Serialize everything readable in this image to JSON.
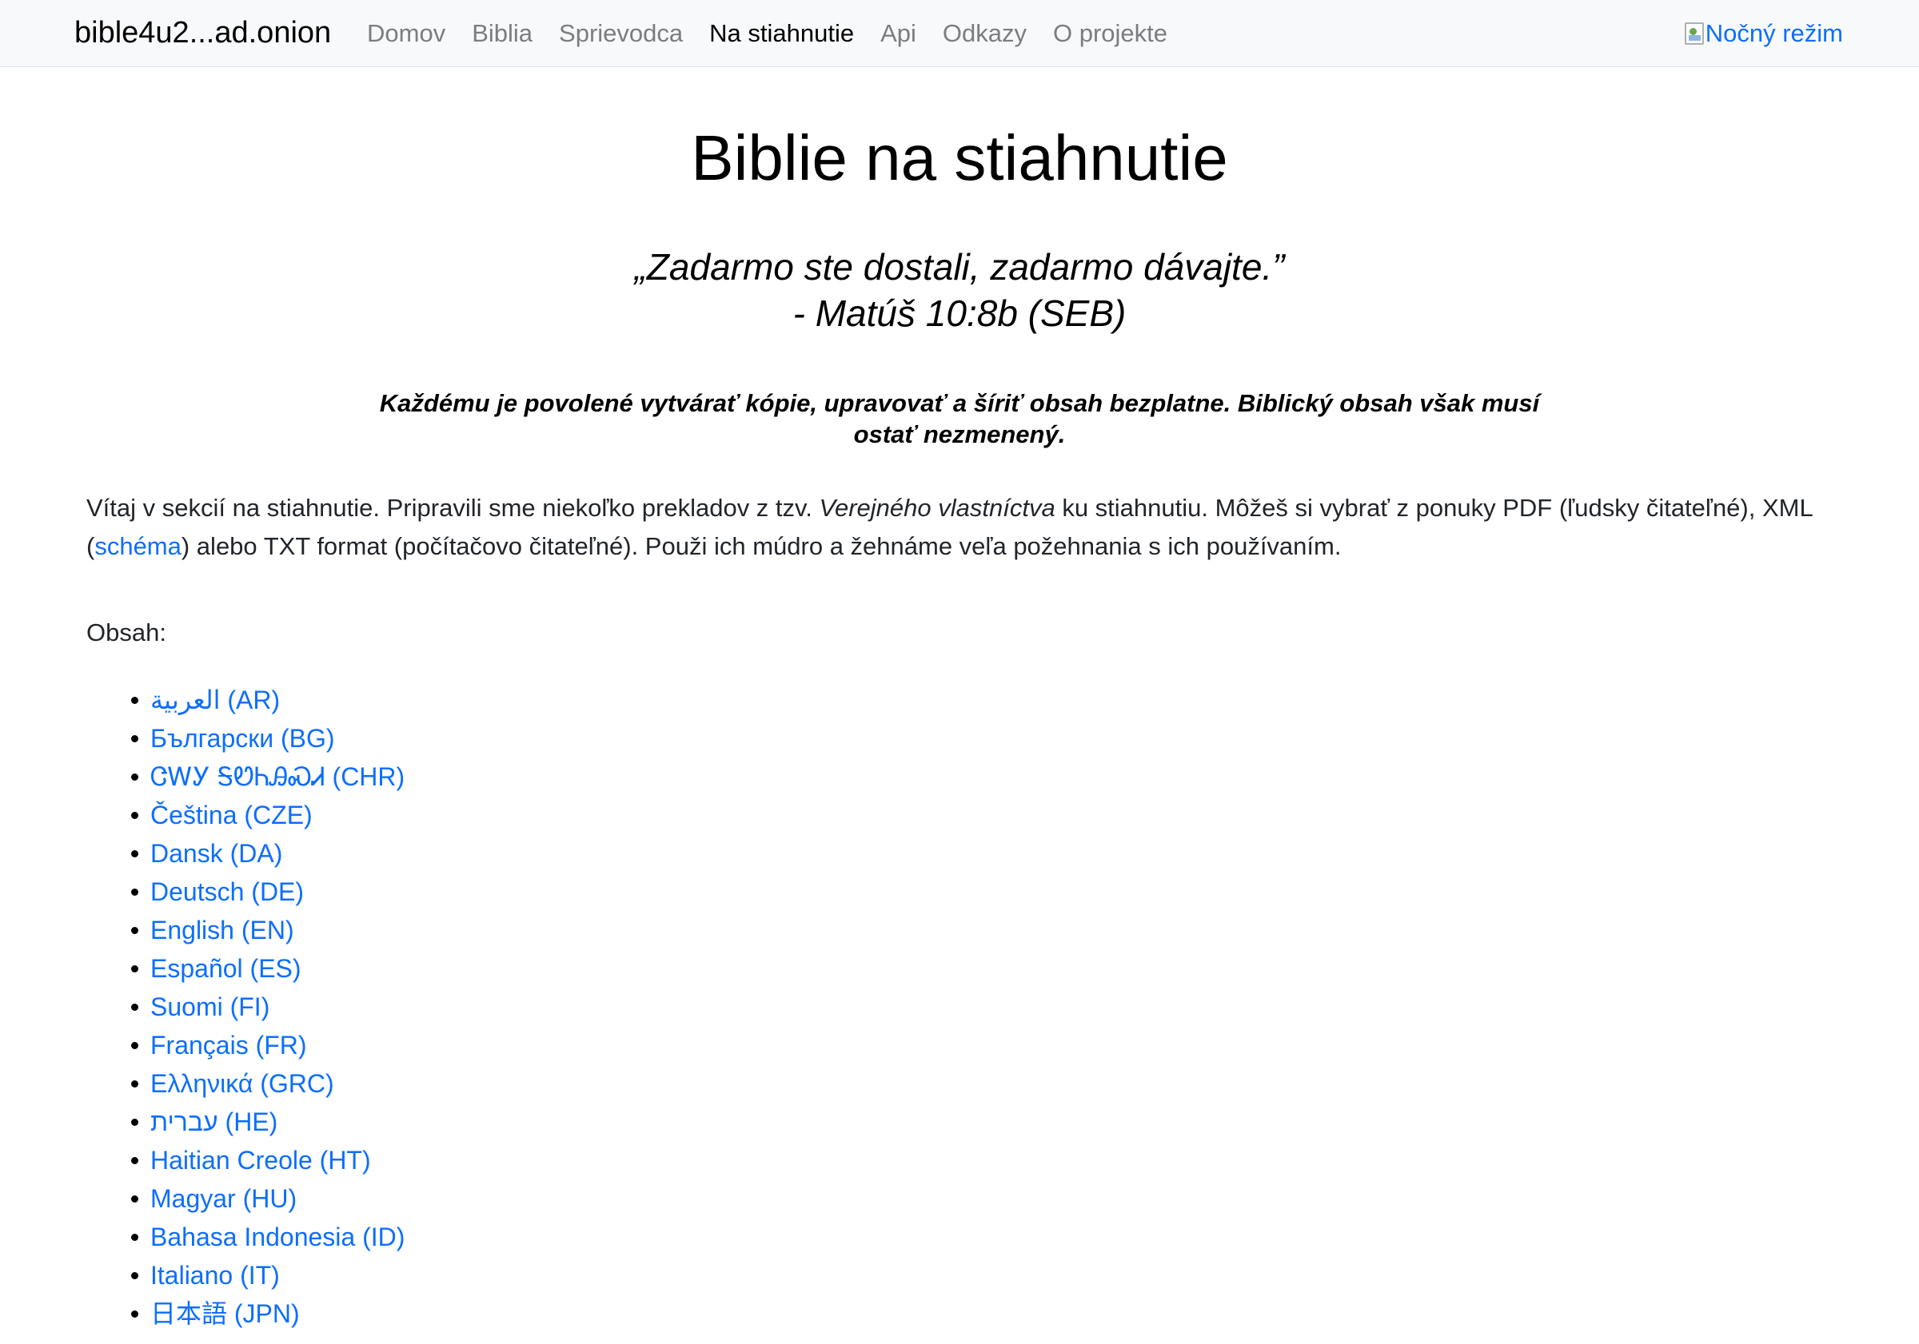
{
  "navbar": {
    "brand": "bible4u2...ad.onion",
    "links": [
      {
        "label": "Domov",
        "active": false
      },
      {
        "label": "Biblia",
        "active": false
      },
      {
        "label": "Sprievodca",
        "active": false
      },
      {
        "label": "Na stiahnutie",
        "active": true
      },
      {
        "label": "Api",
        "active": false
      },
      {
        "label": "Odkazy",
        "active": false
      },
      {
        "label": "O projekte",
        "active": false
      }
    ],
    "night_mode_label": "Nočný režim"
  },
  "main": {
    "title": "Biblie na stiahnutie",
    "quote_line1": "„Zadarmo ste dostali, zadarmo dávajte.”",
    "quote_line2": "- Matúš 10:8b (SEB)",
    "license": "Každému je povolené vytvárať kópie, upravovať a šíriť obsah bezplatne. Biblický obsah však musí ostať nezmenený.",
    "intro": {
      "part1": "Vítaj v sekcií na stiahnutie. Pripravili sme niekoľko prekladov z tzv. ",
      "emphasis": "Verejného vlastníctva",
      "part2": " ku stiahnutiu. Môžeš si vybrať z ponuky PDF (ľudsky čitateľné), XML (",
      "link": "schéma",
      "part3": ") alebo TXT format (počítačovo čitateľné). Použi ich múdro a žehnáme veľa požehnania s ich používaním."
    },
    "contents_label": "Obsah:",
    "languages": [
      "العربية (AR)",
      "Български (BG)",
      "ᏣᎳᎩ ᎦᏬᏂᎯᏍᏗ (CHR)",
      "Čeština (CZE)",
      "Dansk (DA)",
      "Deutsch (DE)",
      "English (EN)",
      "Español (ES)",
      "Suomi (FI)",
      "Français (FR)",
      "Ελληνικά (GRC)",
      "עברית (HE)",
      "Haitian Creole (HT)",
      "Magyar (HU)",
      "Bahasa Indonesia (ID)",
      "Italiano (IT)",
      "日本語 (JPN)"
    ]
  },
  "colors": {
    "link": "#0d6efd",
    "navbar_bg": "#f8f9fa",
    "nav_muted": "#7a7d81"
  }
}
